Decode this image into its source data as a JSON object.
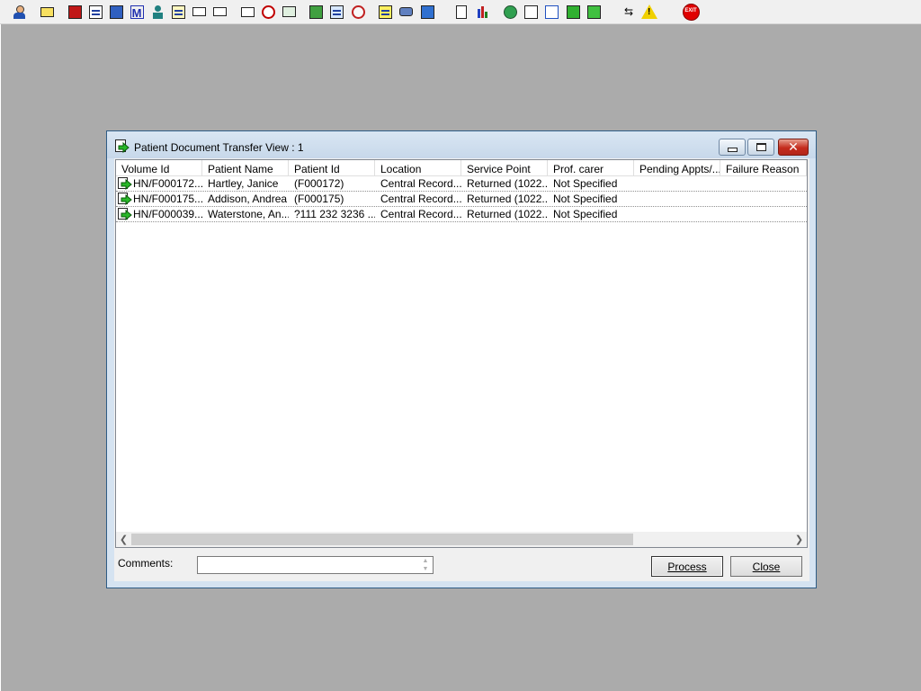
{
  "toolbar": {
    "icons": [
      "user-admin-icon",
      "print-icon",
      "book-icon",
      "document-edit-icon",
      "image-gallery-icon",
      "letter-m-icon",
      "person-icon",
      "notepad-icon",
      "card-icon",
      "card-pointer-icon",
      "mail-search-icon",
      "clock-icon",
      "monitor-icon",
      "screen-icon",
      "form-icon",
      "chart-pie-icon",
      "notes-icon",
      "car-icon",
      "transfer-icon",
      "page-icon",
      "bar-chart-icon",
      "globe-icon",
      "inbox-icon",
      "check-document-icon",
      "green-check-icon",
      "transfer-green-icon",
      "swap-arrows-icon",
      "warning-icon",
      "exit-icon"
    ],
    "exit_label": "EXIT"
  },
  "window": {
    "title": "Patient Document Transfer View : 1"
  },
  "table": {
    "columns": [
      "Volume Id",
      "Patient Name",
      "Patient Id",
      "Location",
      "Service Point",
      "Prof. carer",
      "Pending Appts/...",
      "Failure Reason"
    ],
    "rows": [
      [
        "HN/F000172...",
        "Hartley, Janice",
        "(F000172)",
        "Central Record...",
        "Returned (1022...",
        "Not Specified",
        "",
        ""
      ],
      [
        "HN/F000175...",
        "Addison, Andrea",
        "(F000175)",
        "Central Record...",
        "Returned (1022...",
        "Not Specified",
        "",
        ""
      ],
      [
        "HN/F000039...",
        "Waterstone, An...",
        "?111 232 3236 ...",
        "Central Record...",
        "Returned (1022...",
        "Not Specified",
        "",
        ""
      ]
    ]
  },
  "comments": {
    "label": "Comments:",
    "value": ""
  },
  "buttons": {
    "process_label": "Process",
    "close_label": "Close"
  },
  "colors": {
    "desktop": "#ababab",
    "title_gradient_top": "#d9e6f3",
    "close_button": "#c42b1c"
  }
}
